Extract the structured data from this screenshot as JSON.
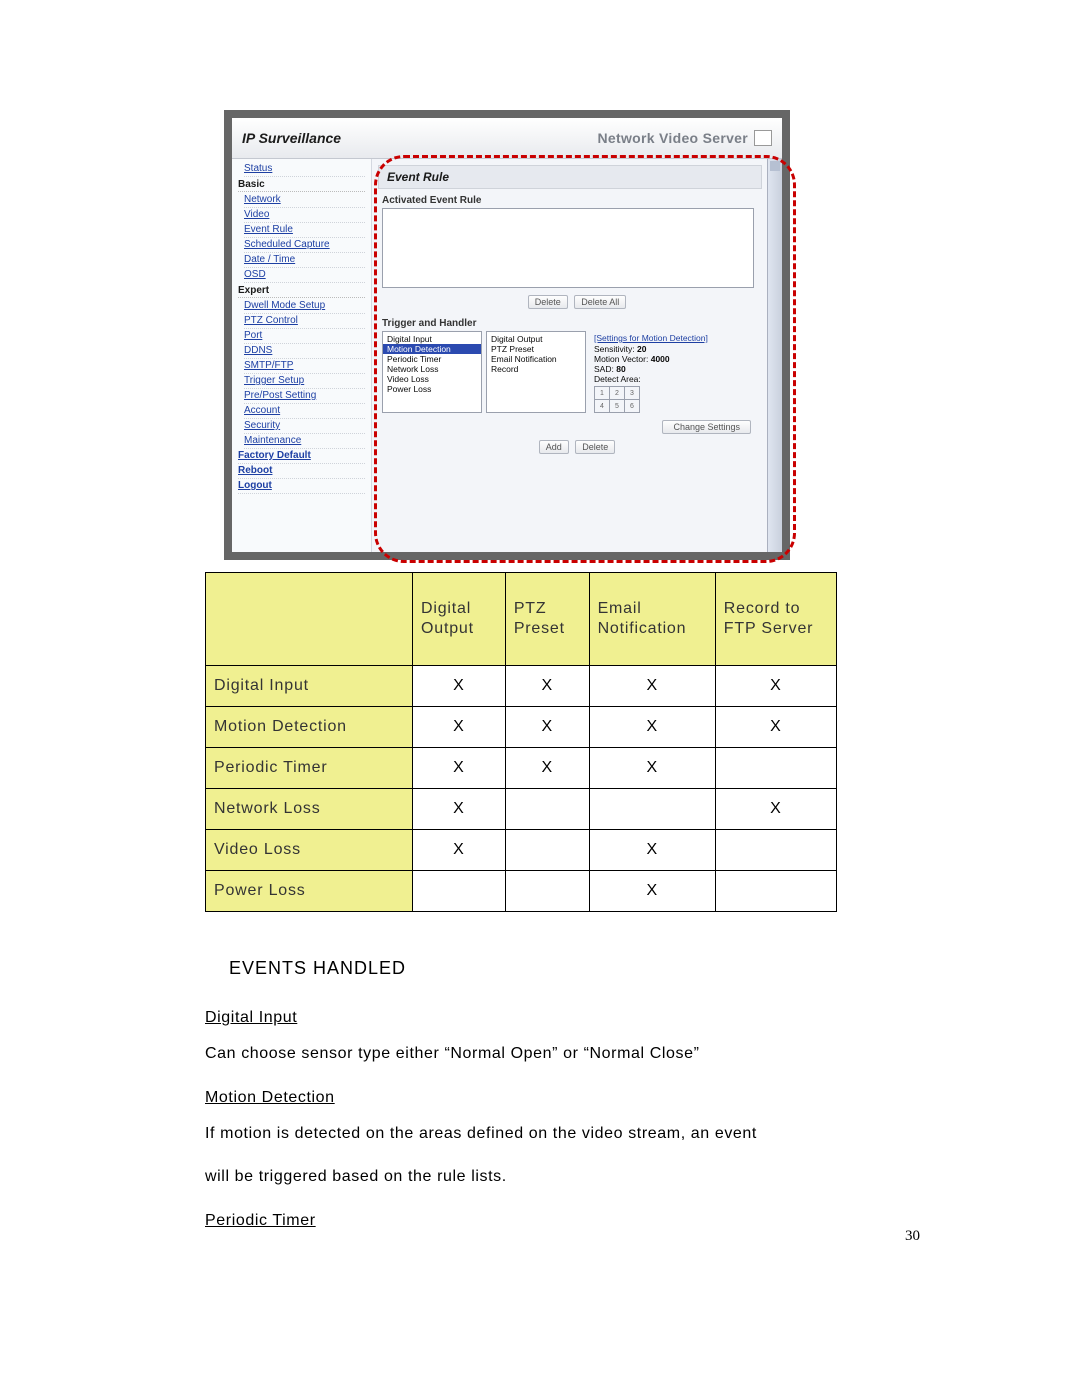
{
  "screenshot": {
    "app_title": "IP Surveillance",
    "brand": "Network Video Server",
    "sidebar": {
      "top_link": "Status",
      "groups": [
        {
          "title": "Basic",
          "items": [
            "Network",
            "Video",
            "Event Rule",
            "Scheduled Capture",
            "Date / Time",
            "OSD"
          ]
        },
        {
          "title": "Expert",
          "items": [
            "Dwell Mode Setup",
            "PTZ Control",
            "Port",
            "DDNS",
            "SMTP/FTP",
            "Trigger Setup",
            "Pre/Post Setting",
            "Account",
            "Security",
            "Maintenance"
          ]
        }
      ],
      "footer": [
        "Factory Default",
        "Reboot",
        "Logout"
      ]
    },
    "main": {
      "header": "Event Rule",
      "activated_label": "Activated Event Rule",
      "buttons_top": {
        "delete": "Delete",
        "delete_all": "Delete All"
      },
      "trigger_handler_label": "Trigger and Handler",
      "triggers": [
        "Digital Input",
        "Motion Detection",
        "Periodic Timer",
        "Network Loss",
        "Video Loss",
        "Power Loss"
      ],
      "trigger_selected": "Motion Detection",
      "handlers": [
        "Digital Output",
        "PTZ Preset",
        "Email Notification",
        "Record"
      ],
      "settings_title": "[Settings for Motion Detection]",
      "settings_kv": [
        {
          "k": "Sensitivity:",
          "v": "20"
        },
        {
          "k": "Motion Vector:",
          "v": "4000"
        },
        {
          "k": "SAD:",
          "v": "80"
        }
      ],
      "detect_area_label": "Detect Area:",
      "change_settings": "Change Settings",
      "buttons_bottom": {
        "add": "Add",
        "delete": "Delete"
      }
    }
  },
  "compat_table": {
    "col_headers": [
      "Digital Output",
      "PTZ Preset",
      "Email Notification",
      "Record to FTP Server"
    ],
    "rows": [
      {
        "label": "Digital Input",
        "cells": [
          "X",
          "X",
          "X",
          "X"
        ]
      },
      {
        "label": "Motion Detection",
        "cells": [
          "X",
          "X",
          "X",
          "X"
        ]
      },
      {
        "label": "Periodic Timer",
        "cells": [
          "X",
          "X",
          "X",
          ""
        ]
      },
      {
        "label": "Network Loss",
        "cells": [
          "X",
          "",
          "",
          "X"
        ]
      },
      {
        "label": "Video Loss",
        "cells": [
          "X",
          "",
          "X",
          ""
        ]
      },
      {
        "label": "Power Loss",
        "cells": [
          "",
          "",
          "X",
          ""
        ]
      }
    ]
  },
  "text": {
    "section_heading": "EVENTS HANDLED",
    "h_digital_input": "Digital Input",
    "p_digital_input": "Can choose sensor type either “Normal Open” or “Normal Close”",
    "h_motion": "Motion Detection",
    "p_motion_1": "If motion is detected on the areas defined on the video stream, an event",
    "p_motion_2": "will be triggered based on the rule lists.",
    "h_periodic": "Periodic Timer"
  },
  "page_number": "30"
}
